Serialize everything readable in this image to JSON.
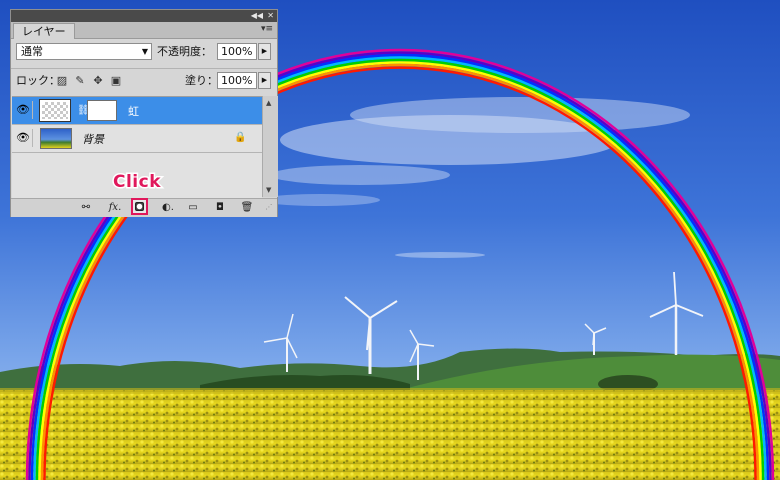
{
  "panel": {
    "tab_label": "レイヤー",
    "blend_mode": "通常",
    "opacity_label": "不透明度：",
    "opacity_value": "100%",
    "lock_label": "ロック：",
    "fill_label": "塗り：",
    "fill_value": "100%",
    "layers": [
      {
        "name": "虹",
        "selected": true,
        "has_mask": true,
        "locked": false
      },
      {
        "name": "背景",
        "selected": false,
        "has_mask": false,
        "locked": true
      }
    ],
    "bottom_icons": [
      "link-icon",
      "fx-icon",
      "add-mask-icon",
      "adjustment-icon",
      "folder-icon",
      "new-layer-icon",
      "trash-icon"
    ]
  },
  "annotation": {
    "label": "Click",
    "color": "#e0185c"
  },
  "colors": {
    "selected_layer": "#3c8ee8",
    "sky_top": "#1f4fc0",
    "field": "#e6d419"
  }
}
